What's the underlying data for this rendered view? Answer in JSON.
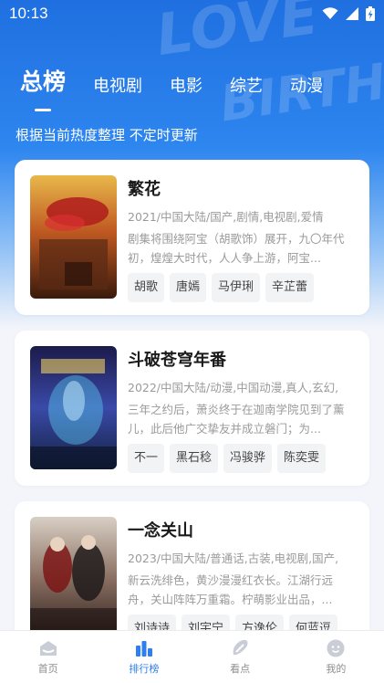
{
  "status_bar": {
    "time": "10:13"
  },
  "tabs": [
    {
      "label": "总榜",
      "active": true
    },
    {
      "label": "电视剧",
      "active": false
    },
    {
      "label": "电影",
      "active": false
    },
    {
      "label": "综艺",
      "active": false
    },
    {
      "label": "动漫",
      "active": false
    }
  ],
  "subtitle": "根据当前热度整理 不定时更新",
  "cards": [
    {
      "title": "繁花",
      "meta": "2021/中国大陆/国产,剧情,电视剧,爱情",
      "desc": "剧集将围绕阿宝（胡歌饰）展开，九〇年代初，煌煌大时代，人人争上游，阿宝...",
      "tags": [
        "胡歌",
        "唐嫣",
        "马伊琍",
        "辛芷蕾"
      ]
    },
    {
      "title": "斗破苍穹年番",
      "meta": "2022/中国大陆/动漫,中国动漫,真人,玄幻,",
      "desc": "三年之约后，萧炎终于在迦南学院见到了薰儿，此后他广交挚友并成立磐门；为...",
      "tags": [
        "不一",
        "黑石稔",
        "冯骏骅",
        "陈奕雯"
      ]
    },
    {
      "title": "一念关山",
      "meta": "2023/中国大陆/普通话,古装,电视剧,国产,",
      "desc": "新云洗绯色，黄沙漫漫红衣长。江湖行远舟，关山阵阵万重霜。柠萌影业出品，...",
      "tags": [
        "刘诗诗",
        "刘宇宁",
        "方逸伦",
        "何蓝逗"
      ]
    }
  ],
  "nav": [
    {
      "label": "首页",
      "icon": "home-icon",
      "active": false
    },
    {
      "label": "排行榜",
      "icon": "ranking-icon",
      "active": true
    },
    {
      "label": "看点",
      "icon": "highlights-icon",
      "active": false
    },
    {
      "label": "我的",
      "icon": "profile-icon",
      "active": false
    }
  ],
  "colors": {
    "accent": "#2f7ff0",
    "header": "#1f6fe0"
  }
}
